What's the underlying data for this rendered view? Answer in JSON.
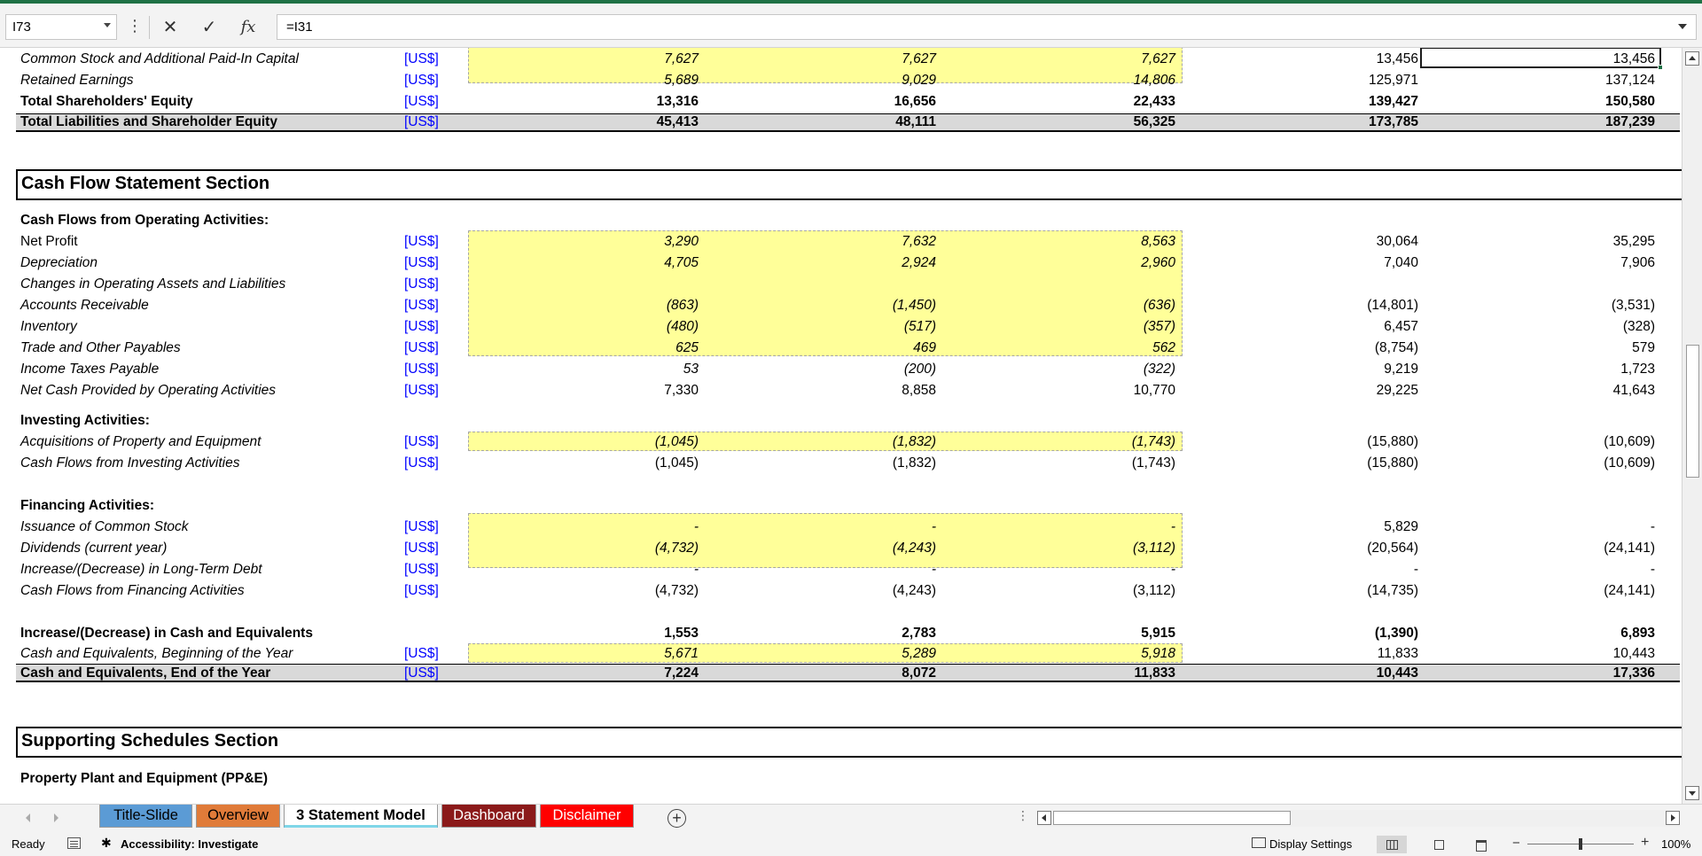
{
  "formula_bar": {
    "name_box": "I73",
    "formula": "=I31",
    "fx_label": "fx"
  },
  "balance_rows": [
    {
      "label": "Common Stock and Additional Paid-In Capital",
      "unit": "[US$]",
      "v1": "7,627",
      "v2": "7,627",
      "v3": "7,627",
      "v4": "13,456",
      "v5": "13,456"
    },
    {
      "label": "Retained Earnings",
      "unit": "[US$]",
      "v1": "5,689",
      "v2": "9,029",
      "v3": "14,806",
      "v4": "125,971",
      "v5": "137,124"
    },
    {
      "label": "Total Shareholders' Equity",
      "unit": "[US$]",
      "v1": "13,316",
      "v2": "16,656",
      "v3": "22,433",
      "v4": "139,427",
      "v5": "150,580"
    },
    {
      "label": "Total Liabilities and Shareholder Equity",
      "unit": "[US$]",
      "v1": "45,413",
      "v2": "48,111",
      "v3": "56,325",
      "v4": "173,785",
      "v5": "187,239"
    }
  ],
  "cash_flow": {
    "section_title": "Cash Flow Statement Section",
    "operating_header": "Cash Flows from Operating Activities:",
    "operating_rows": [
      {
        "label": "Net Profit",
        "unit": "[US$]",
        "v1": "3,290",
        "v2": "7,632",
        "v3": "8,563",
        "v4": "30,064",
        "v5": "35,295"
      },
      {
        "label": "Depreciation",
        "unit": "[US$]",
        "v1": "4,705",
        "v2": "2,924",
        "v3": "2,960",
        "v4": "7,040",
        "v5": "7,906"
      },
      {
        "label": "Changes in Operating Assets and Liabilities",
        "unit": "[US$]",
        "v1": "",
        "v2": "",
        "v3": "",
        "v4": "",
        "v5": ""
      },
      {
        "label": "Accounts Receivable",
        "unit": "[US$]",
        "v1": "(863)",
        "v2": "(1,450)",
        "v3": "(636)",
        "v4": "(14,801)",
        "v5": "(3,531)"
      },
      {
        "label": "Inventory",
        "unit": "[US$]",
        "v1": "(480)",
        "v2": "(517)",
        "v3": "(357)",
        "v4": "6,457",
        "v5": "(328)"
      },
      {
        "label": "Trade and Other Payables",
        "unit": "[US$]",
        "v1": "625",
        "v2": "469",
        "v3": "562",
        "v4": "(8,754)",
        "v5": "579"
      },
      {
        "label": "Income Taxes Payable",
        "unit": "[US$]",
        "v1": "53",
        "v2": "(200)",
        "v3": "(322)",
        "v4": "9,219",
        "v5": "1,723"
      },
      {
        "label": "Net Cash Provided by Operating Activities",
        "unit": "[US$]",
        "v1": "7,330",
        "v2": "8,858",
        "v3": "10,770",
        "v4": "29,225",
        "v5": "41,643"
      }
    ],
    "investing_header": "Investing Activities:",
    "investing_rows": [
      {
        "label": "Acquisitions of Property and Equipment",
        "unit": "[US$]",
        "v1": "(1,045)",
        "v2": "(1,832)",
        "v3": "(1,743)",
        "v4": "(15,880)",
        "v5": "(10,609)"
      },
      {
        "label": "Cash Flows from Investing Activities",
        "unit": "[US$]",
        "v1": "(1,045)",
        "v2": "(1,832)",
        "v3": "(1,743)",
        "v4": "(15,880)",
        "v5": "(10,609)"
      }
    ],
    "financing_header": "Financing Activities:",
    "financing_rows": [
      {
        "label": "Issuance of Common Stock",
        "unit": "[US$]",
        "v1": "-",
        "v2": "-",
        "v3": "-",
        "v4": "5,829",
        "v5": "-"
      },
      {
        "label": "Dividends (current year)",
        "unit": "[US$]",
        "v1": "(4,732)",
        "v2": "(4,243)",
        "v3": "(3,112)",
        "v4": "(20,564)",
        "v5": "(24,141)"
      },
      {
        "label": "Increase/(Decrease) in Long-Term Debt",
        "unit": "[US$]",
        "v1": "-",
        "v2": "-",
        "v3": "-",
        "v4": "-",
        "v5": "-"
      },
      {
        "label": "Cash Flows from Financing Activities",
        "unit": "[US$]",
        "v1": "(4,732)",
        "v2": "(4,243)",
        "v3": "(3,112)",
        "v4": "(14,735)",
        "v5": "(24,141)"
      }
    ],
    "summary_rows": [
      {
        "label": "Increase/(Decrease) in Cash and Equivalents",
        "unit": "",
        "v1": "1,553",
        "v2": "2,783",
        "v3": "5,915",
        "v4": "(1,390)",
        "v5": "6,893"
      },
      {
        "label": "Cash and Equivalents, Beginning of the Year",
        "unit": "[US$]",
        "v1": "5,671",
        "v2": "5,289",
        "v3": "5,918",
        "v4": "11,833",
        "v5": "10,443"
      },
      {
        "label": "Cash and Equivalents, End of the Year",
        "unit": "[US$]",
        "v1": "7,224",
        "v2": "8,072",
        "v3": "11,833",
        "v4": "10,443",
        "v5": "17,336"
      }
    ]
  },
  "supporting": {
    "section_title": "Supporting Schedules Section",
    "ppe_header": "Property Plant and Equipment (PP&E)"
  },
  "sheet_tabs": [
    "Title-Slide",
    "Overview",
    "3 Statement Model",
    "Dashboard",
    "Disclaimer"
  ],
  "status_bar": {
    "ready": "Ready",
    "accessibility": "Accessibility: Investigate",
    "display_settings": "Display Settings",
    "zoom": "100%"
  },
  "colors": {
    "input_fill": "#ffff99",
    "unit_blue": "#0000ff",
    "total_shade": "#d9d9d9",
    "excel_green": "#1e7145",
    "tab_title_slide": "#5b9bd5",
    "tab_overview": "#e07b39",
    "tab_dashboard": "#8b1a1a",
    "tab_disclaimer": "#ff0000"
  }
}
